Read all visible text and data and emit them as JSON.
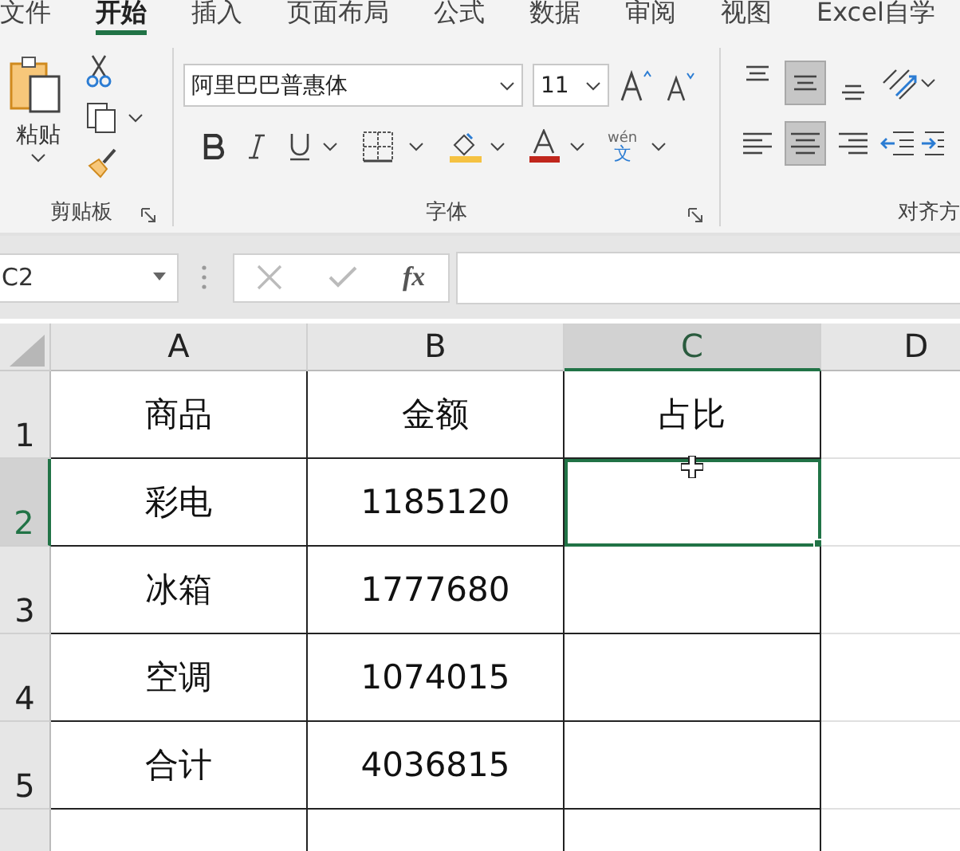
{
  "tabs": [
    {
      "label": "文件",
      "selected": false
    },
    {
      "label": "开始",
      "selected": true
    },
    {
      "label": "插入",
      "selected": false
    },
    {
      "label": "页面布局",
      "selected": false
    },
    {
      "label": "公式",
      "selected": false
    },
    {
      "label": "数据",
      "selected": false
    },
    {
      "label": "审阅",
      "selected": false
    },
    {
      "label": "视图",
      "selected": false
    },
    {
      "label": "Excel自学",
      "selected": false
    }
  ],
  "clipboard": {
    "paste_label": "粘贴",
    "group_label": "剪贴板"
  },
  "font": {
    "font_name": "阿里巴巴普惠体",
    "font_size": "11",
    "phonetic_top": "wén",
    "phonetic_bottom": "文",
    "group_label": "字体"
  },
  "alignment": {
    "group_label": "对齐方",
    "vertical": [
      {
        "kind": "top",
        "selected": false
      },
      {
        "kind": "middle",
        "selected": true
      },
      {
        "kind": "bottom",
        "selected": false
      }
    ],
    "horizontal": [
      {
        "kind": "left",
        "selected": false
      },
      {
        "kind": "center",
        "selected": true
      },
      {
        "kind": "right",
        "selected": false
      }
    ]
  },
  "formula_bar": {
    "name_box": "C2",
    "fx": "fx"
  },
  "sheet": {
    "columns": [
      {
        "label": "A",
        "selected": false
      },
      {
        "label": "B",
        "selected": false
      },
      {
        "label": "C",
        "selected": true
      },
      {
        "label": "D",
        "selected": false
      }
    ],
    "rows": [
      {
        "header": "1",
        "selected": false,
        "cells": [
          {
            "text": "商品",
            "selected": false
          },
          {
            "text": "金额",
            "selected": false
          },
          {
            "text": "占比",
            "selected": false
          },
          {
            "selected": false
          }
        ]
      },
      {
        "header": "2",
        "selected": true,
        "cells": [
          {
            "text": "彩电",
            "selected": false
          },
          {
            "text": "1185120",
            "selected": false
          },
          {
            "selected": true
          },
          {
            "selected": false
          }
        ]
      },
      {
        "header": "3",
        "selected": false,
        "cells": [
          {
            "text": "冰箱",
            "selected": false
          },
          {
            "text": "1777680",
            "selected": false
          },
          {
            "selected": false
          },
          {
            "selected": false
          }
        ]
      },
      {
        "header": "4",
        "selected": false,
        "cells": [
          {
            "text": "空调",
            "selected": false
          },
          {
            "text": "1074015",
            "selected": false
          },
          {
            "selected": false
          },
          {
            "selected": false
          }
        ]
      },
      {
        "header": "5",
        "selected": false,
        "cells": [
          {
            "text": "合计",
            "selected": false
          },
          {
            "text": "4036815",
            "selected": false
          },
          {
            "selected": false
          },
          {
            "selected": false
          }
        ]
      }
    ]
  }
}
